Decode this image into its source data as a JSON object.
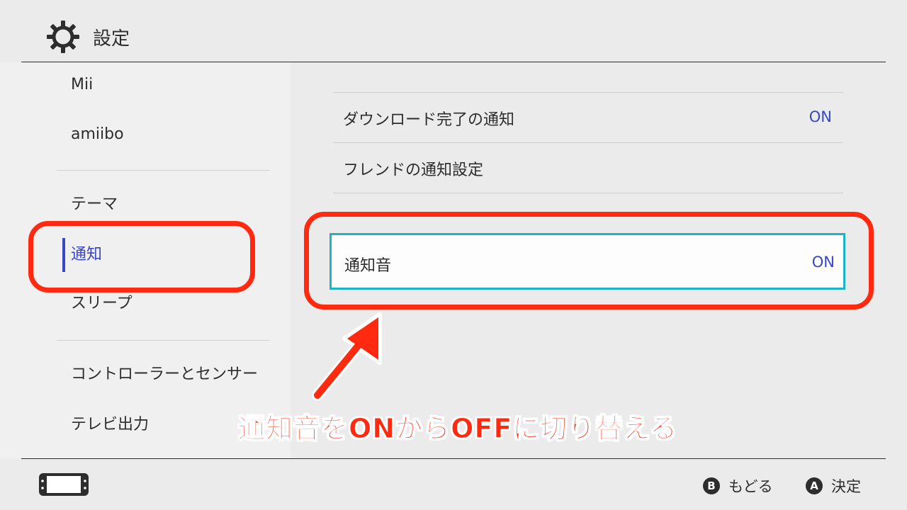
{
  "header": {
    "title": "設定",
    "icon": "gear-icon"
  },
  "sidebar": {
    "items": [
      {
        "label": "Mii"
      },
      {
        "label": "amiibo"
      },
      {
        "label": "テーマ"
      },
      {
        "label": "通知",
        "active": true
      },
      {
        "label": "スリープ"
      },
      {
        "label": "コントローラーとセンサー"
      },
      {
        "label": "テレビ出力"
      }
    ]
  },
  "main": {
    "rows": [
      {
        "label": "ダウンロード完了の通知",
        "value": "ON"
      },
      {
        "label": "フレンドの通知設定",
        "value": ""
      }
    ],
    "selected_row": {
      "label": "通知音",
      "value": "ON"
    }
  },
  "annotation": {
    "text": "通知音をONからOFFに切り替える",
    "color": "#ff2a0f"
  },
  "footer": {
    "back": {
      "button": "B",
      "label": "もどる"
    },
    "ok": {
      "button": "A",
      "label": "決定"
    }
  },
  "colors": {
    "accent": "#3947c4",
    "selection": "#1fb4c4",
    "highlight": "#ff2a0f"
  }
}
